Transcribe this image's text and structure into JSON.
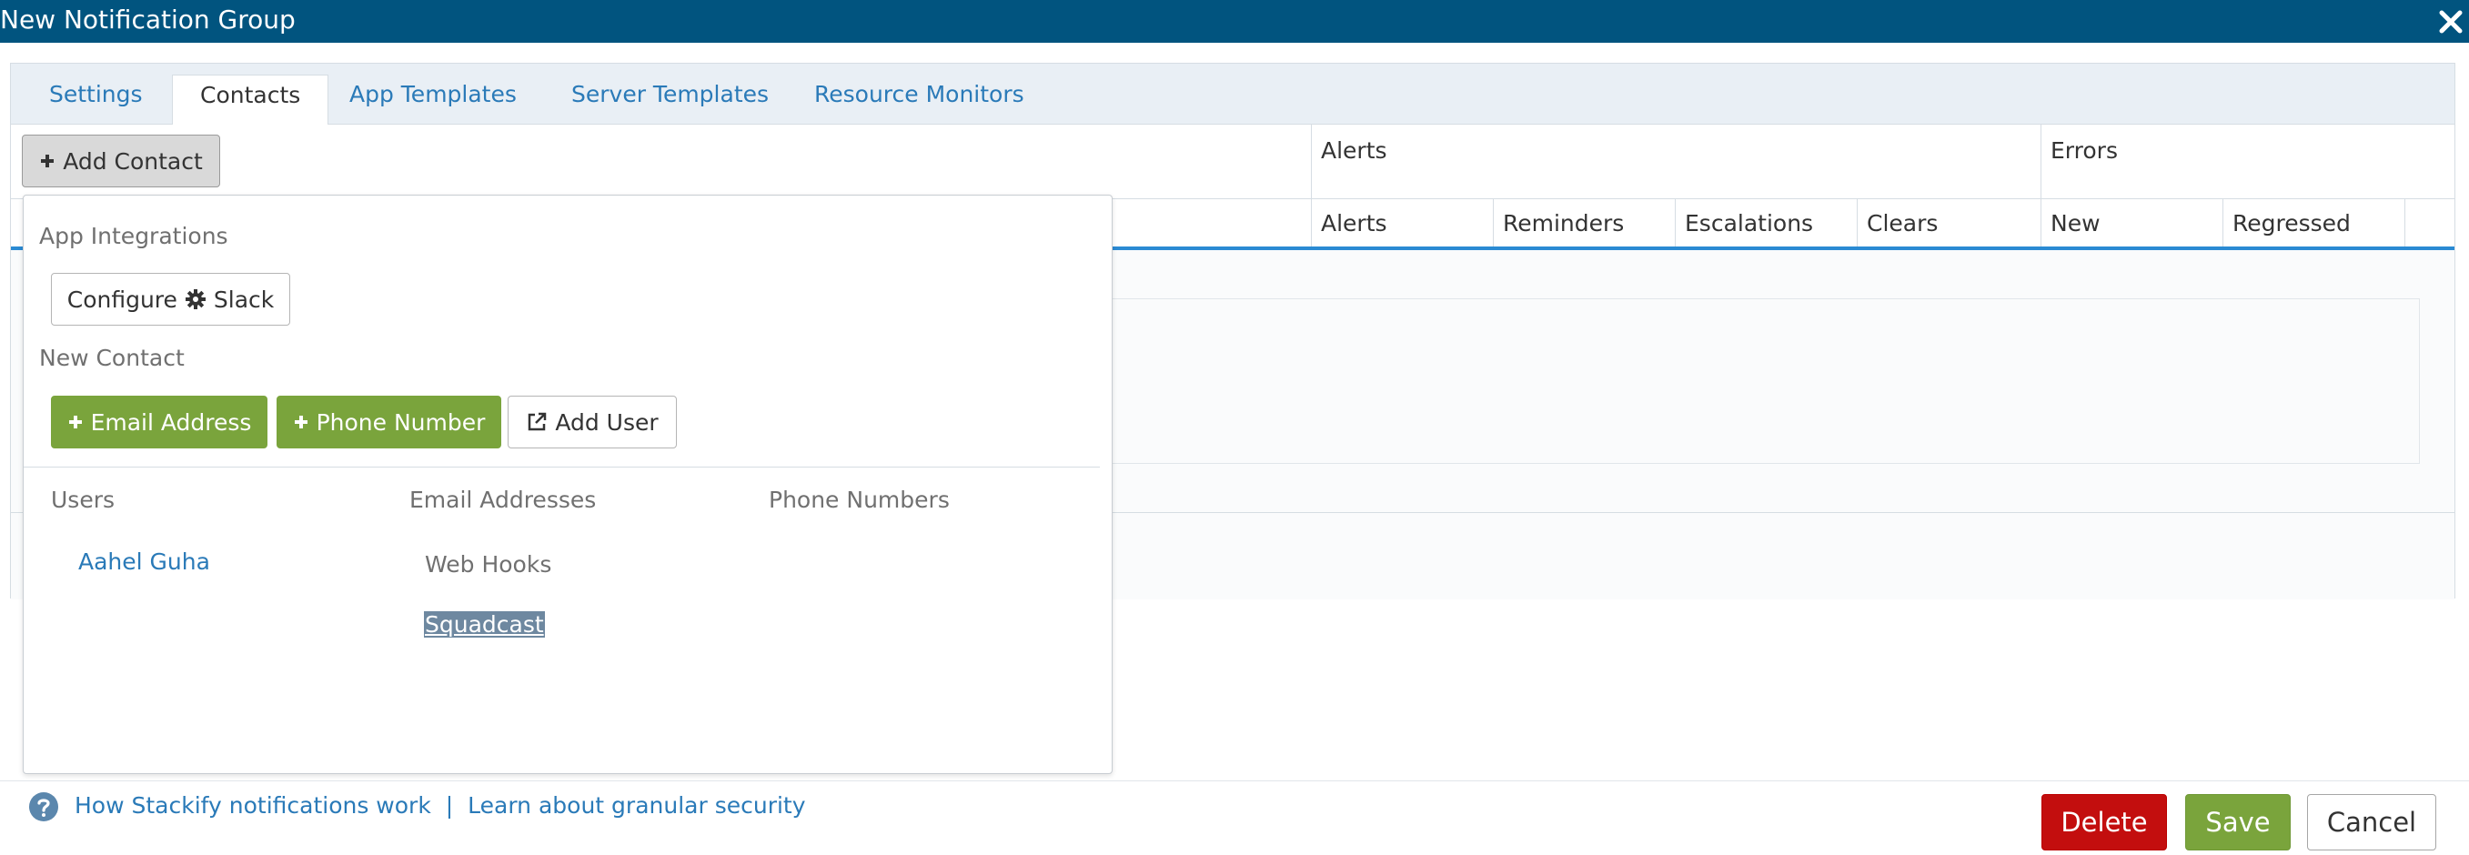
{
  "window": {
    "title": "New Notification Group"
  },
  "tabs": [
    {
      "label": "Settings"
    },
    {
      "label": "Contacts"
    },
    {
      "label": "App Templates"
    },
    {
      "label": "Server Templates"
    },
    {
      "label": "Resource Monitors"
    }
  ],
  "active_tab": "Contacts",
  "grid": {
    "groups": {
      "alerts": "Alerts",
      "errors": "Errors"
    },
    "columns": {
      "alerts": "Alerts",
      "reminders": "Reminders",
      "escalations": "Escalations",
      "clears": "Clears",
      "new": "New",
      "regressed": "Regressed"
    }
  },
  "add_contact": {
    "label": "Add Contact"
  },
  "dropdown": {
    "app_integrations_label": "App Integrations",
    "configure_prefix": "Configure",
    "configure_suffix": "Slack",
    "new_contact_label": "New Contact",
    "email_btn": "Email Address",
    "phone_btn": "Phone Number",
    "add_user_btn": "Add User",
    "col_users": "Users",
    "col_emails": "Email Addresses",
    "col_phones": "Phone Numbers",
    "user_1": "Aahel Guha",
    "webhooks_label": "Web Hooks",
    "webhook_1": "Squadcast"
  },
  "footer": {
    "help_link_1": "How Stackify notifications work",
    "separator": "|",
    "help_link_2": "Learn about granular security",
    "delete": "Delete",
    "save": "Save",
    "cancel": "Cancel"
  },
  "colors": {
    "titlebar": "#01547f",
    "link": "#2a7ab8",
    "green": "#7aa43c",
    "red": "#c30e0e",
    "accent_line": "#2a8ad3"
  },
  "icons": [
    "close-icon",
    "plus-icon",
    "gear-icon",
    "external-link-icon",
    "question-icon"
  ]
}
